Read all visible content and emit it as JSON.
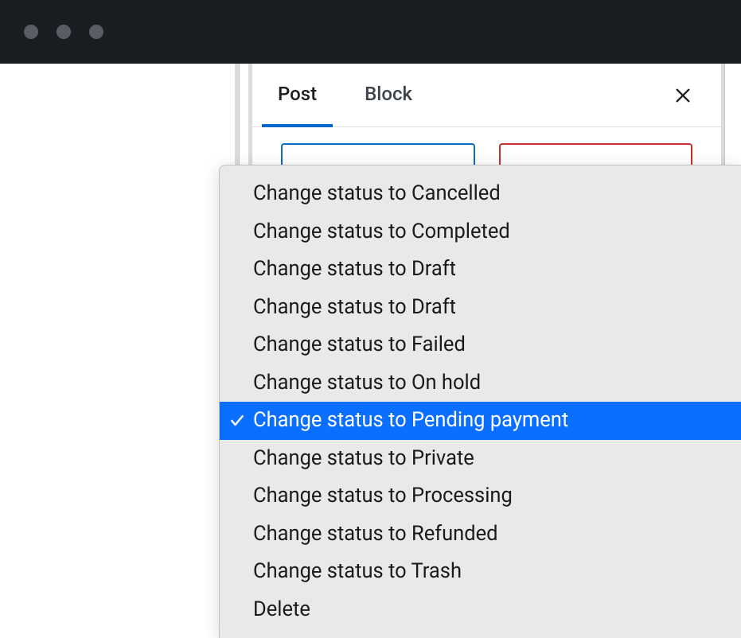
{
  "titlebar": {},
  "panel": {
    "tabs": [
      {
        "label": "Post",
        "active": true
      },
      {
        "label": "Block",
        "active": false
      }
    ]
  },
  "context_menu": {
    "items": [
      {
        "label": "Change status to Cancelled",
        "selected": false
      },
      {
        "label": "Change status to Completed",
        "selected": false
      },
      {
        "label": "Change status to Draft",
        "selected": false
      },
      {
        "label": "Change status to Draft",
        "selected": false
      },
      {
        "label": "Change status to Failed",
        "selected": false
      },
      {
        "label": "Change status to On hold",
        "selected": false
      },
      {
        "label": "Change status to Pending payment",
        "selected": true
      },
      {
        "label": "Change status to Private",
        "selected": false
      },
      {
        "label": "Change status to Processing",
        "selected": false
      },
      {
        "label": "Change status to Refunded",
        "selected": false
      },
      {
        "label": "Change status to Trash",
        "selected": false
      },
      {
        "label": "Delete",
        "selected": false
      }
    ]
  }
}
